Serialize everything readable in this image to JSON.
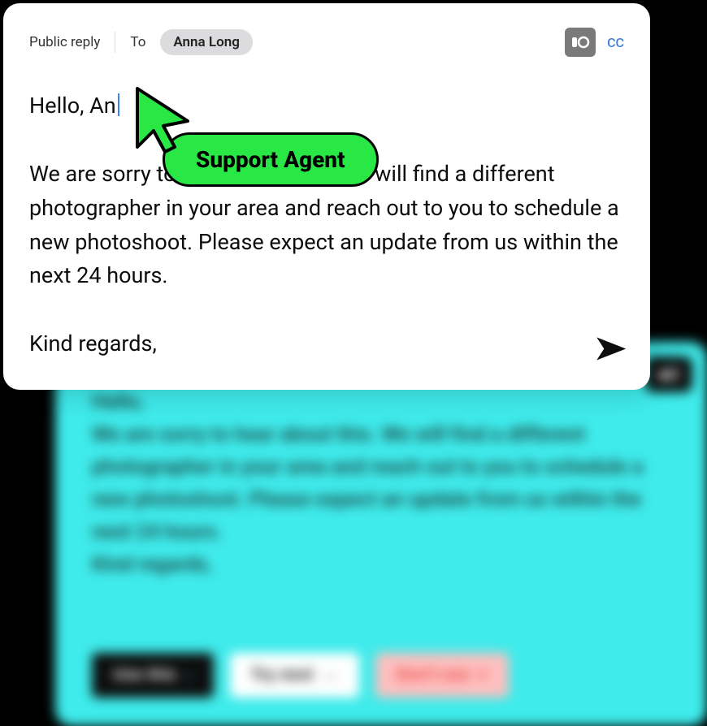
{
  "front_card": {
    "header": {
      "reply_type": "Public reply",
      "to_label": "To",
      "recipient": "Anna Long",
      "cc_label": "CC"
    },
    "message": {
      "greeting_prefix": "Hello, An",
      "body": "We are sorry to hear about this. We will find a different photographer in your area and reach out to you to schedule a new photoshoot. Please expect an update from us within the next 24 hours.",
      "closing": "Kind regards,"
    }
  },
  "cursor_badge": {
    "label": "Support Agent"
  },
  "back_card": {
    "greeting": "Hello,",
    "body": "We are sorry to hear about this. We will find a different photographer in your area and reach out to you to schedule a new photoshoot. Please expect an update from us within the next 24 hours.",
    "closing": "Kind regards,",
    "buttons": {
      "use_this": "Use this",
      "try_next": "Try next",
      "dont_use": "Don't use"
    }
  }
}
